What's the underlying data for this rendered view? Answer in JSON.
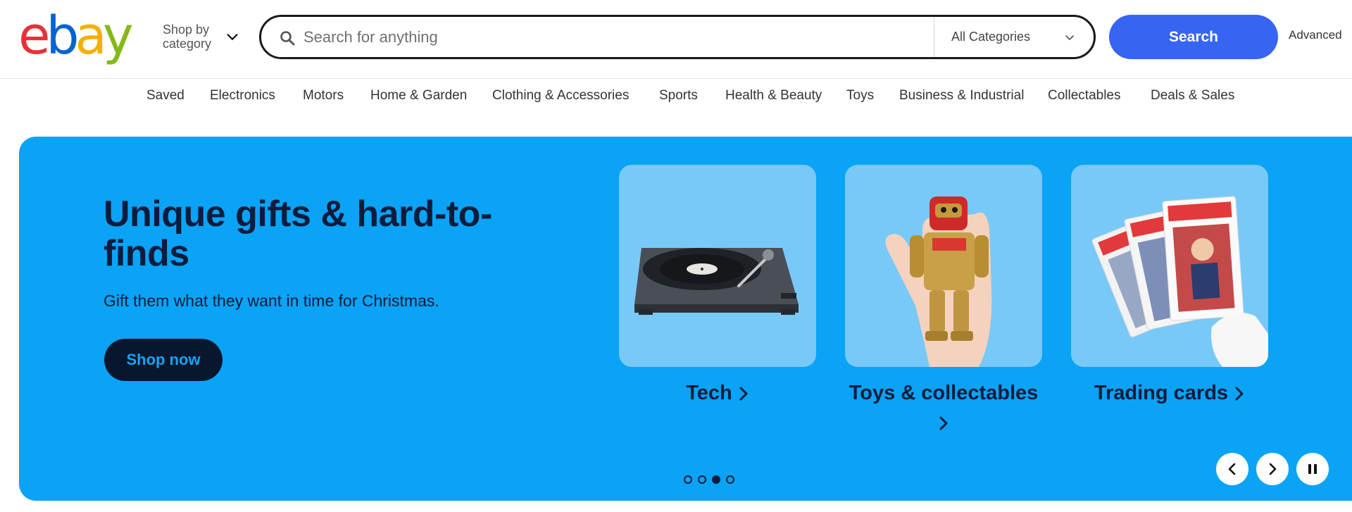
{
  "header": {
    "logo": {
      "e": "e",
      "b": "b",
      "a": "a",
      "y": "y"
    },
    "shop_by": "Shop by category",
    "search": {
      "placeholder": "Search for anything",
      "value": ""
    },
    "category_select": "All Categories",
    "search_button": "Search",
    "advanced": "Advanced"
  },
  "nav": {
    "items": [
      "Saved",
      "Electronics",
      "Motors",
      "Home & Garden",
      "Clothing & Accessories",
      "Sports",
      "Health & Beauty",
      "Toys",
      "Business & Industrial",
      "Collectables",
      "Deals & Sales"
    ]
  },
  "hero": {
    "title": "Unique gifts & hard-to-finds",
    "subtitle": "Gift them what they want in time for Christmas.",
    "cta": "Shop now",
    "cards": [
      {
        "label": "Tech",
        "icon": "turntable-image"
      },
      {
        "label": "Toys & collectables",
        "icon": "robot-toy-image"
      },
      {
        "label": "Trading cards",
        "icon": "graded-cards-image"
      }
    ],
    "carousel": {
      "slides": 4,
      "active_slide": 3
    },
    "colors": {
      "background": "#0aa3f6",
      "text": "#0e1c3b",
      "button": "#08172e"
    }
  },
  "colors": {
    "brand_red": "#e53238",
    "brand_blue": "#0064d2",
    "brand_yellow": "#f5af02",
    "brand_green": "#86b817",
    "search_button": "#3665f3"
  }
}
